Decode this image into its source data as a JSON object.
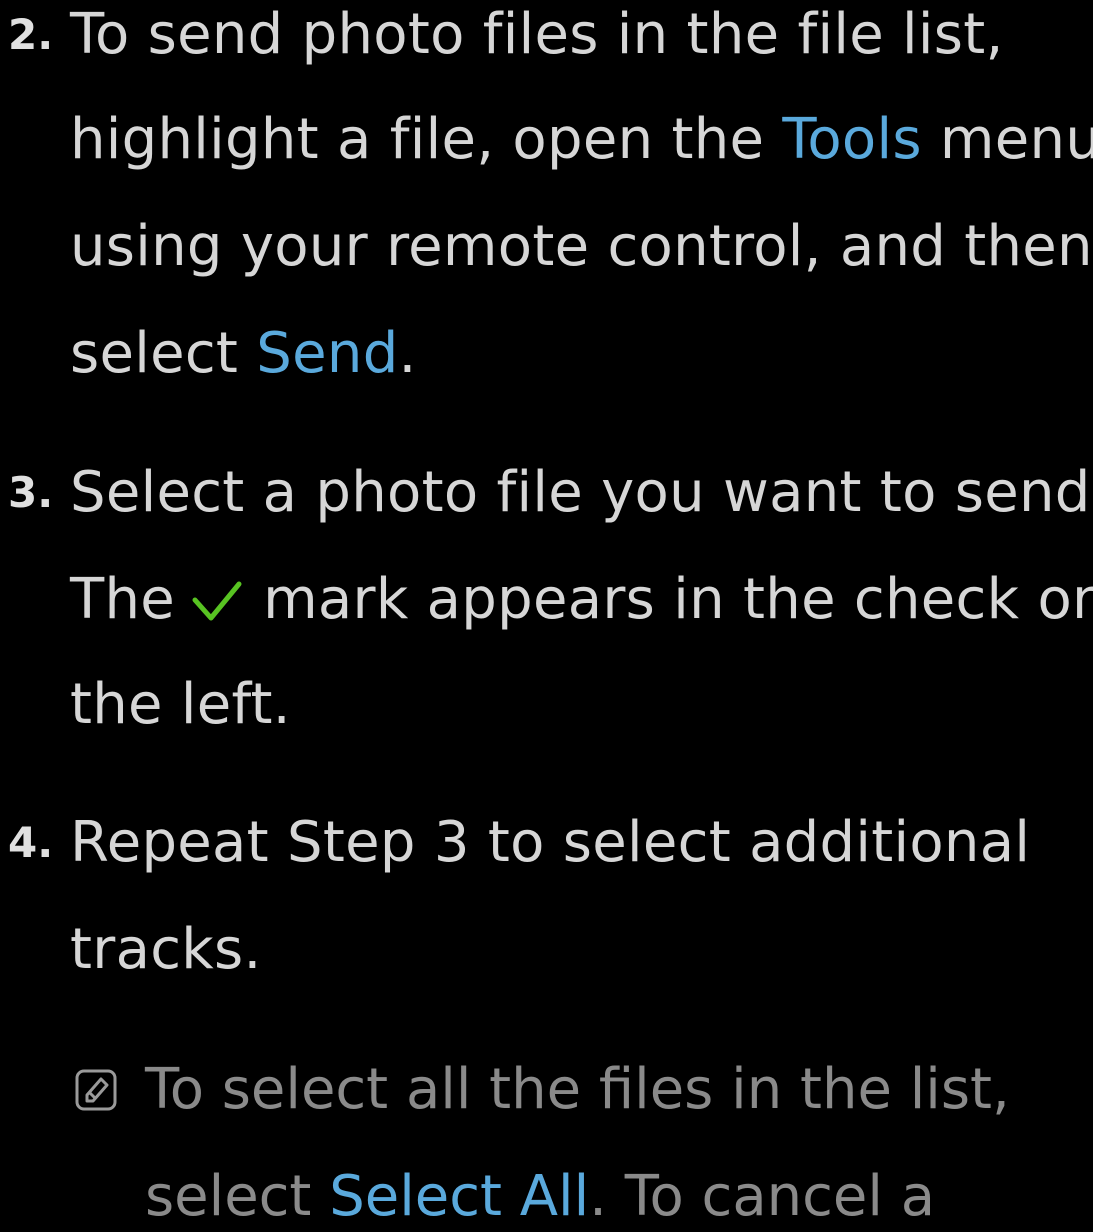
{
  "steps": [
    {
      "number": "2.",
      "lines": [
        {
          "a": "To send photo files in the file list,"
        },
        {
          "a": "highlight a file, open the ",
          "hl": "Tools",
          "b": " menu"
        },
        {
          "a": "using your remote control, and then"
        },
        {
          "a": "select ",
          "hl": "Send",
          "b": "."
        }
      ]
    },
    {
      "number": "3.",
      "lines": [
        {
          "a": "Select a photo file you want to send."
        },
        {
          "a": "The",
          "icon": "checkmark-icon",
          "b": "mark appears in the check on"
        },
        {
          "a": "the left."
        }
      ]
    },
    {
      "number": "4.",
      "lines": [
        {
          "a": "Repeat Step 3 to select additional"
        },
        {
          "a": "tracks."
        }
      ]
    }
  ],
  "note": {
    "icon": "note-icon",
    "lines": [
      {
        "a": "To select all the files in the list,"
      },
      {
        "a": "select ",
        "hl": "Select All",
        "b": ". To cancel a"
      }
    ]
  },
  "colors": {
    "background": "#000000",
    "text": "#d6d6d6",
    "highlight": "#5aa9dc",
    "note_text": "#8a8a8a",
    "check": "#58c322"
  }
}
